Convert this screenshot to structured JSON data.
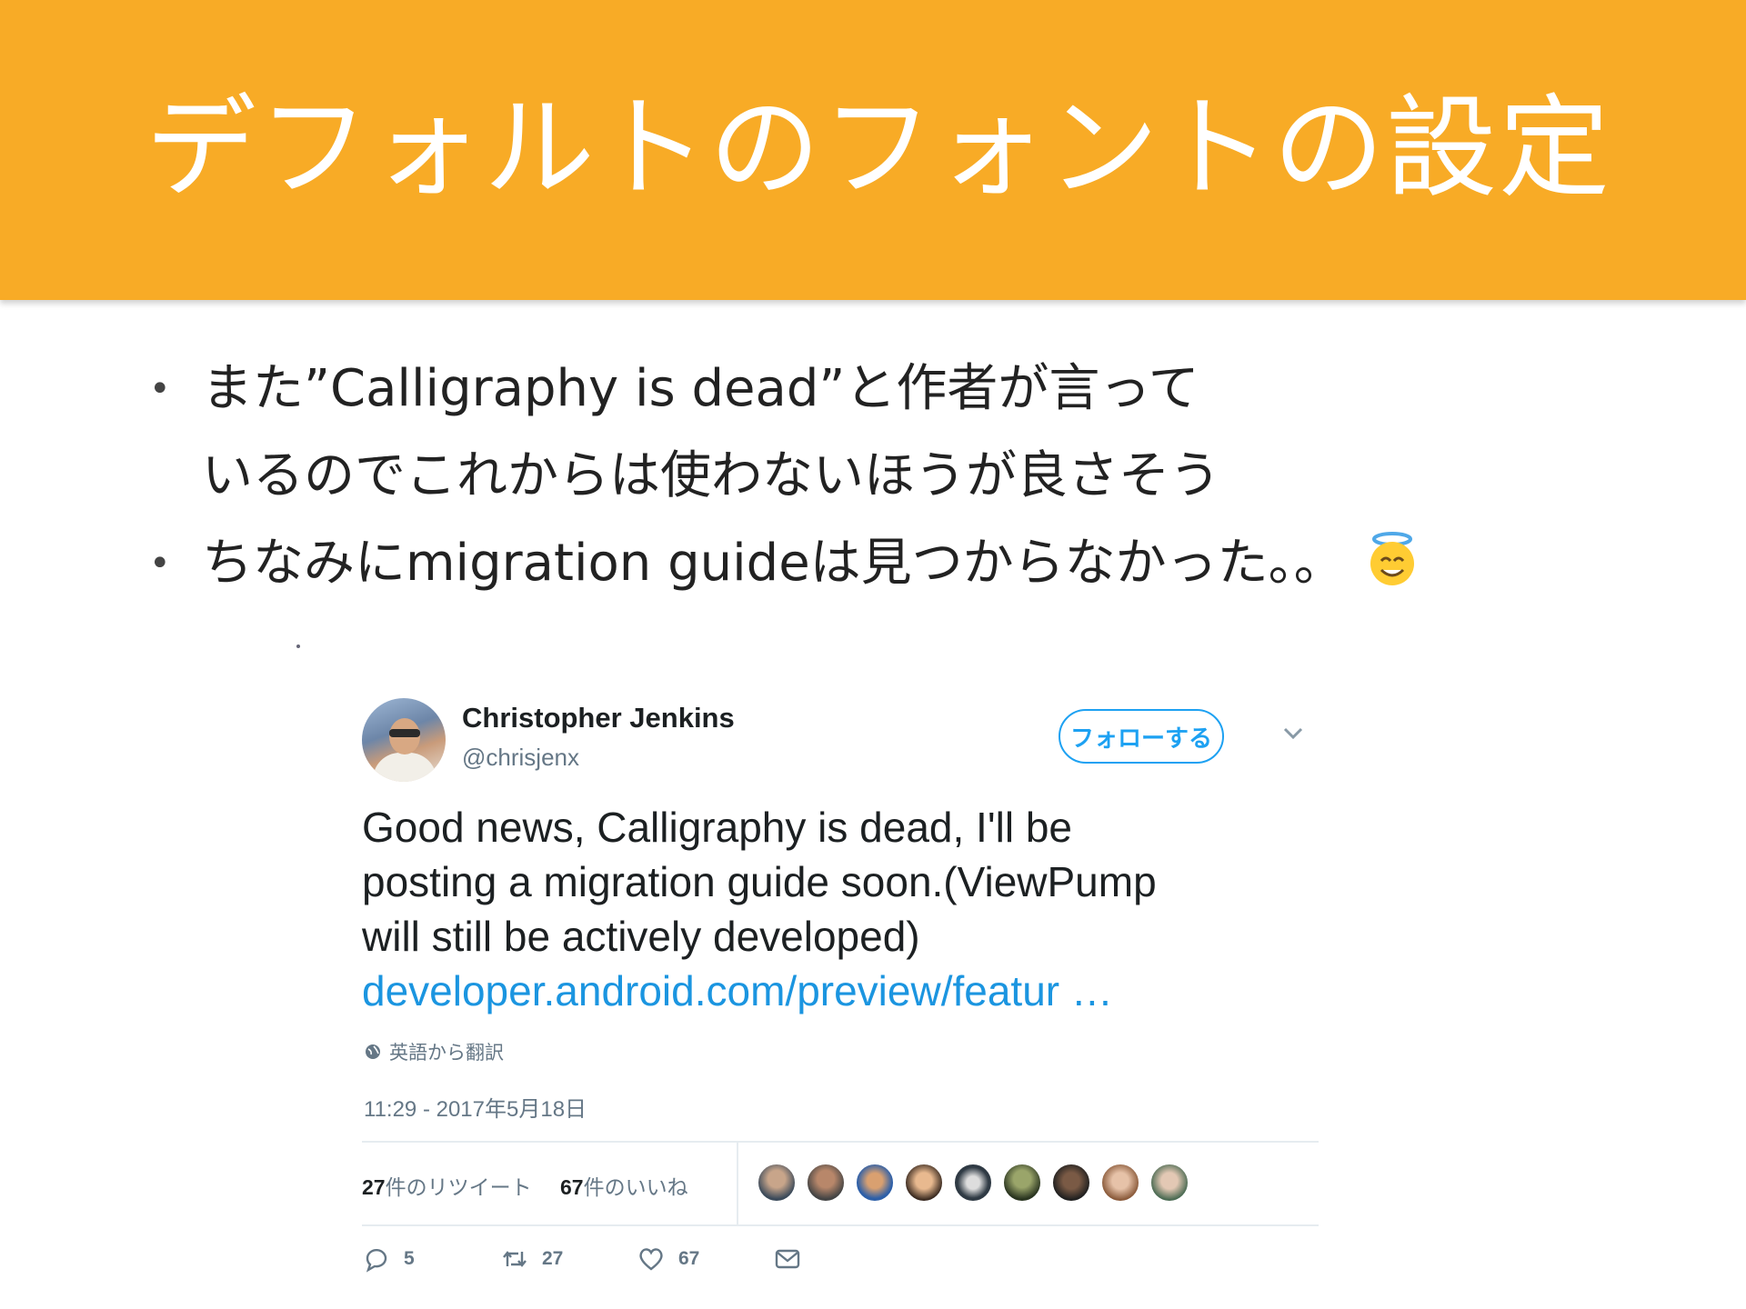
{
  "slide": {
    "title": "デフォルトのフォントの設定",
    "bullets": [
      {
        "line1": "また”Calligraphy is dead”と作者が言って",
        "line2": "いるのでこれからは使わないほうが良さそう"
      },
      {
        "line1": "ちなみにmigration guideは見つからなかった。。",
        "emoji": "smiling-face-with-halo"
      }
    ],
    "colors": {
      "header": "#F8AB26",
      "title_text": "#FFFFFF",
      "body_text": "#222222"
    }
  },
  "tweet": {
    "author_name": "Christopher Jenkins",
    "author_handle": "@chrisjenx",
    "follow_label": "フォローする",
    "body": [
      "Good news, Calligraphy is dead, I'll be",
      "posting a migration guide soon.(ViewPump",
      "will still be actively developed)"
    ],
    "link": "developer.android.com/preview/featur …",
    "translate_label": "英語から翻訳",
    "timestamp": "11:29 - 2017年5月18日",
    "retweets_count": "27",
    "retweets_label": "件のリツイート",
    "likes_count": "67",
    "likes_label": "件のいいね",
    "actions": {
      "reply_count": "5",
      "retweet_count": "27",
      "like_count": "67"
    },
    "colors": {
      "link": "#1b95e0",
      "follow_border": "#1DA1F2",
      "meta": "#657786"
    }
  }
}
